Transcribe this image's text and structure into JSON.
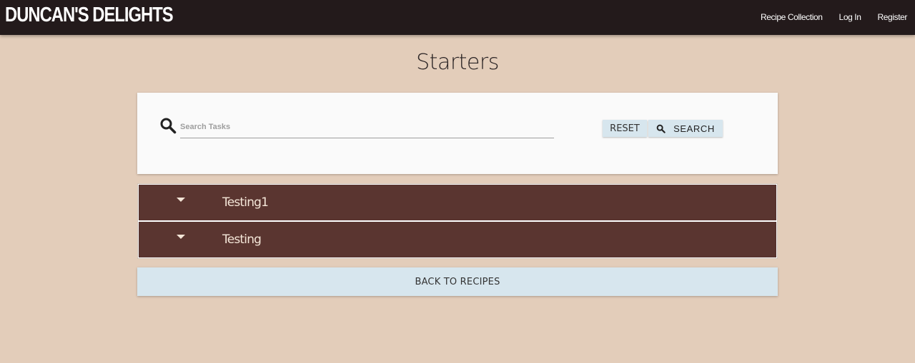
{
  "navbar": {
    "brand": "DUNCAN'S DELIGHTS",
    "links": [
      "Recipe Collection",
      "Log In",
      "Register"
    ]
  },
  "page": {
    "title": "Starters"
  },
  "search": {
    "placeholder": "Search Tasks",
    "value": "",
    "reset_label": "RESET",
    "search_label": "SEARCH"
  },
  "recipes": [
    {
      "name": "Testing1"
    },
    {
      "name": "Testing"
    }
  ],
  "back_label": "BACK TO RECIPES",
  "colors": {
    "navbar": "#231a1b",
    "background": "#e3cdba",
    "accordion": "#5a3530",
    "button": "#d7e6ee"
  },
  "icons": {
    "search": "search-icon",
    "caret": "caret-down-icon"
  }
}
